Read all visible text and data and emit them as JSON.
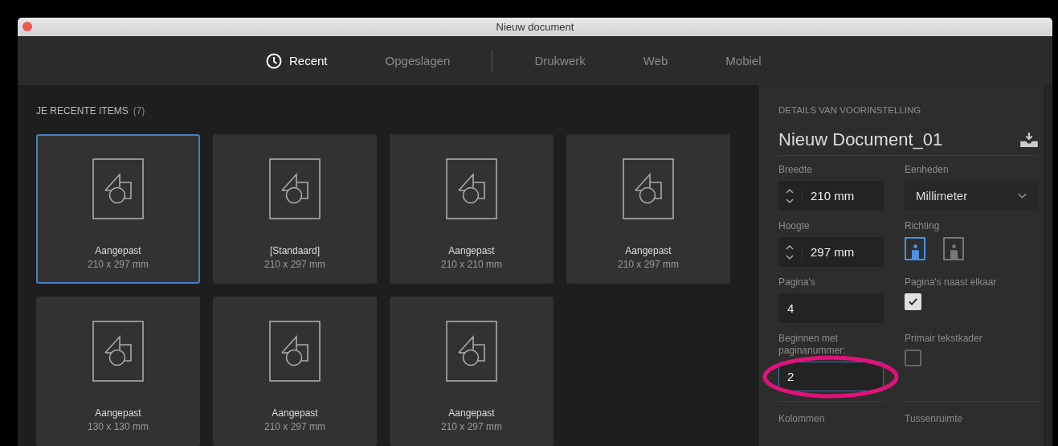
{
  "window": {
    "title": "Nieuw document"
  },
  "tabs": [
    {
      "label": "Recent",
      "selected": true
    },
    {
      "label": "Opgeslagen",
      "selected": false
    },
    {
      "label": "Drukwerk",
      "selected": false
    },
    {
      "label": "Web",
      "selected": false
    },
    {
      "label": "Mobiel",
      "selected": false
    }
  ],
  "recent": {
    "heading": "JE RECENTE ITEMS",
    "count": "(7)",
    "items": [
      {
        "name": "Aangepast",
        "size": "210 x 297 mm",
        "selected": true
      },
      {
        "name": "[Standaard]",
        "size": "210 x 297 mm",
        "selected": false
      },
      {
        "name": "Aangepast",
        "size": "210 x 210 mm",
        "selected": false
      },
      {
        "name": "Aangepast",
        "size": "210 x 297 mm",
        "selected": false
      },
      {
        "name": "Aangepast",
        "size": "130 x 130 mm",
        "selected": false
      },
      {
        "name": "Aangepast",
        "size": "210 x 297 mm",
        "selected": false
      },
      {
        "name": "Aangepast",
        "size": "210 x 297 mm",
        "selected": false
      }
    ]
  },
  "details": {
    "heading": "DETAILS VAN VOORINSTELLING",
    "document_name": "Nieuw Document_01",
    "fields": [
      {
        "kind": "stepper",
        "label": "Breedte",
        "value": "210 mm"
      },
      {
        "kind": "dropdown",
        "label": "Eenheden",
        "value": "Millimeter"
      },
      {
        "kind": "stepper",
        "label": "Hoogte",
        "value": "297 mm"
      },
      {
        "kind": "orientation",
        "label": "Richting",
        "options": [
          {
            "selected": true
          },
          {
            "selected": false
          }
        ]
      },
      {
        "kind": "text",
        "label": "Pagina's",
        "value": "4",
        "focused": false
      },
      {
        "kind": "checkbox",
        "label": "Pagina's naast elkaar",
        "checked": true
      },
      {
        "kind": "text",
        "label": "Beginnen met paginanummer:",
        "value": "2",
        "focused": true,
        "highlighted": true
      },
      {
        "kind": "checkbox",
        "label": "Primair tekstkader",
        "checked": false
      },
      {
        "kind": "divider"
      },
      {
        "kind": "divider"
      },
      {
        "kind": "heading",
        "label": "Kolommen"
      },
      {
        "kind": "heading",
        "label": "Tussenruimte"
      }
    ]
  }
}
